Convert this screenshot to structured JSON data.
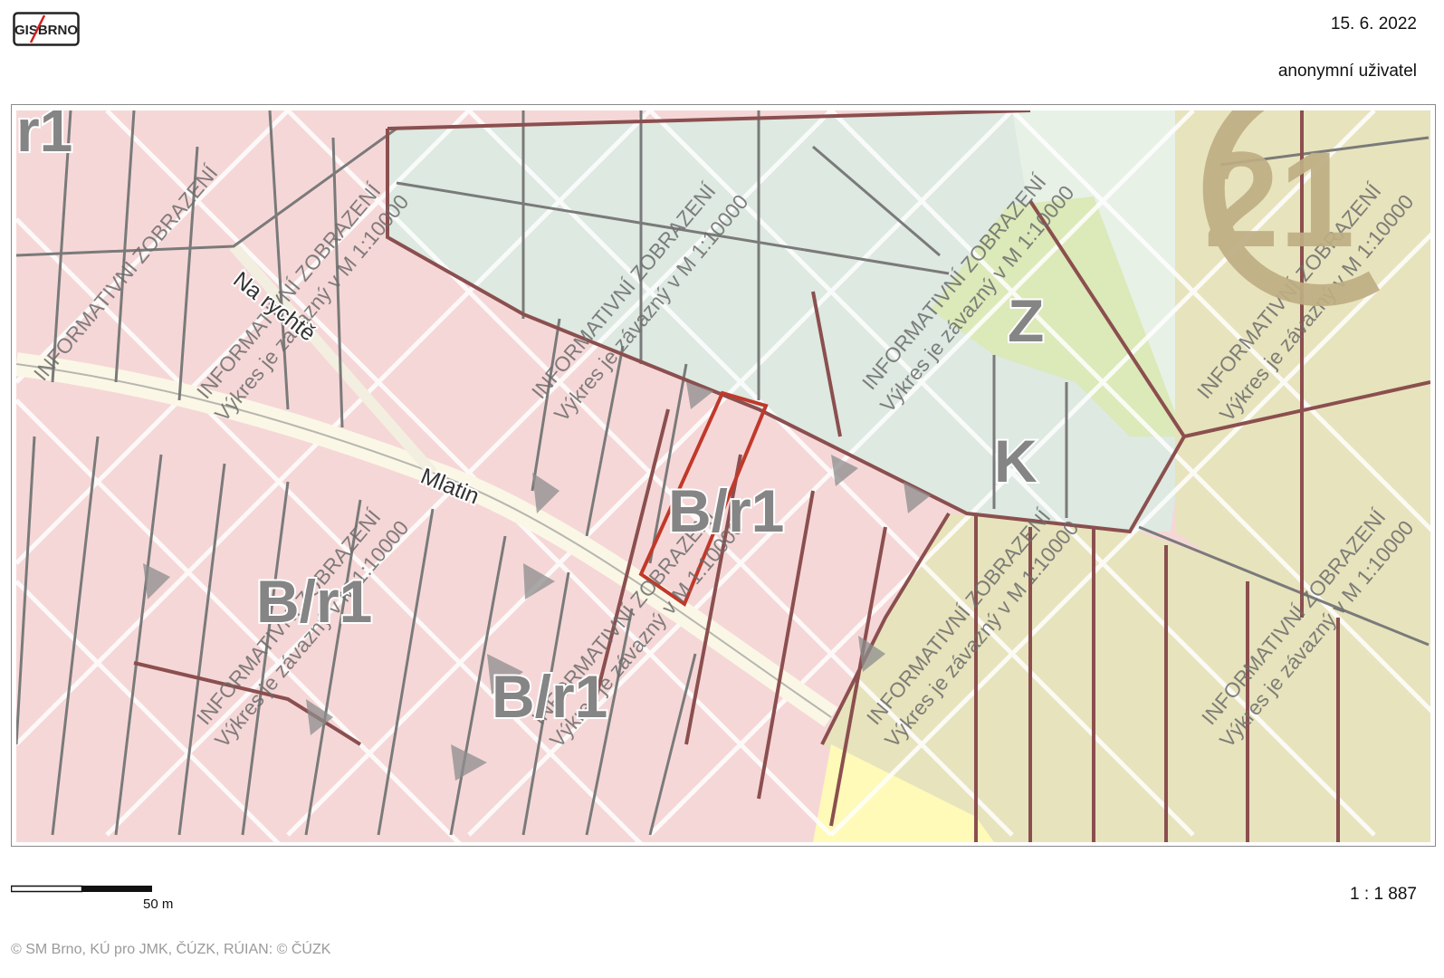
{
  "header": {
    "logo_text": "GIS BRNO",
    "date": "15. 6. 2022",
    "user": "anonymní uživatel"
  },
  "map": {
    "zone_labels": [
      "r1",
      "B/r1",
      "B/r1",
      "B/r1",
      "Z",
      "K"
    ],
    "street_names": [
      "Na rychtě",
      "Mlatin"
    ],
    "watermark_line1": "INFORMATIVNÍ ZOBRAZENÍ",
    "watermark_line2": "Výkres je závazný v M 1:10000",
    "colors": {
      "residential": "#f6d7d7",
      "green": "#dde9e1",
      "meadow": "#dce9b8",
      "agricultural": "#e7e3bc",
      "yellow_zone": "#fffab8",
      "highlight": "#c0392b",
      "brand": "#bfae84"
    },
    "brand_badge": "21"
  },
  "footer": {
    "scale_label": "50 m",
    "ratio": "1 : 1 887",
    "copyright": "© SM Brno, KÚ pro JMK, ČÚZK, RÚIAN: © ČÚZK"
  }
}
